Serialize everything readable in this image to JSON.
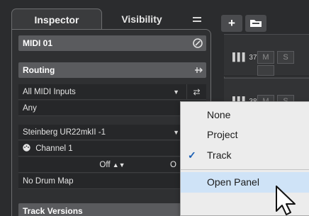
{
  "inspector": {
    "tabs": [
      {
        "label": "Inspector"
      },
      {
        "label": "Visibility"
      }
    ],
    "menu_icon": "hamburger-icon",
    "track_name": "MIDI 01",
    "track_name_icon": "edit-icon",
    "routing": {
      "label": "Routing",
      "icon": "routing-collapse-icon"
    },
    "input": {
      "value": "All MIDI Inputs",
      "side_icon": "input-transformer-icon"
    },
    "input_channel": {
      "value": "Any"
    },
    "output": {
      "value": "Steinberg UR22mkII -1"
    },
    "channel": {
      "value": "Channel 1",
      "icon": "midi-port-icon"
    },
    "bank": {
      "value": "Off",
      "side_value": "O"
    },
    "drum_map": {
      "value": "No Drum Map"
    },
    "track_versions": {
      "label": "Track Versions",
      "icon": "versions-icon"
    }
  },
  "toolbar": {
    "add_label": "+",
    "folder_icon": "folder-icon"
  },
  "tracks": [
    {
      "number": "37",
      "icon": "midi-keyboard-icon",
      "mute": "M",
      "solo": "S"
    },
    {
      "number": "38",
      "icon": "midi-keyboard-icon",
      "mute": "M",
      "solo": "S"
    }
  ],
  "popup_menu": {
    "items": [
      {
        "label": "None",
        "checked": false
      },
      {
        "label": "Project",
        "checked": false
      },
      {
        "label": "Track",
        "checked": true
      },
      {
        "label": "Open Panel",
        "checked": false,
        "highlighted": true
      }
    ],
    "check_glyph": "✓"
  }
}
